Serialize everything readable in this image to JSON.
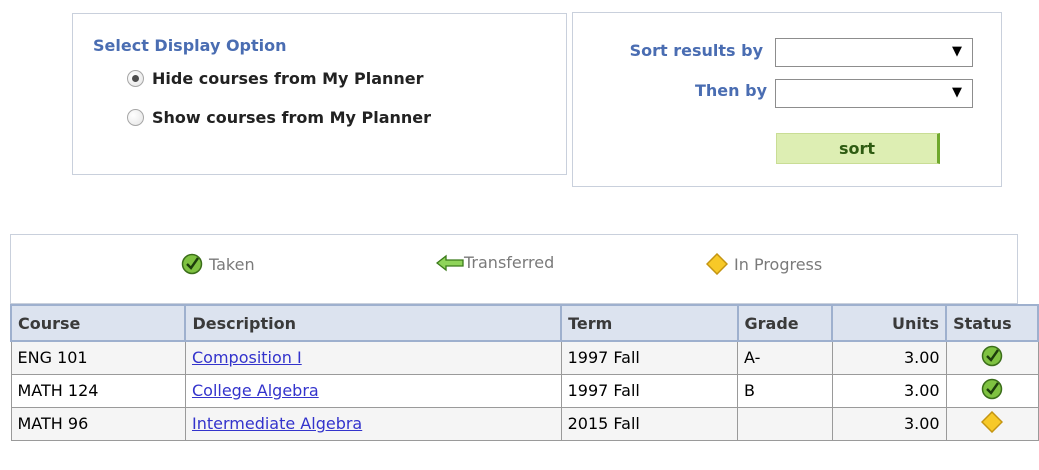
{
  "display_options": {
    "title": "Select Display Option",
    "options": [
      {
        "label": "Hide courses from My Planner",
        "selected": true
      },
      {
        "label": "Show courses from My Planner",
        "selected": false
      }
    ]
  },
  "sort": {
    "sort_by_label": "Sort results by",
    "then_by_label": "Then by",
    "sort_by_value": "",
    "then_by_value": "",
    "button_label": "sort"
  },
  "legend": {
    "taken": "Taken",
    "transferred": "Transferred",
    "in_progress": "In Progress"
  },
  "table": {
    "headers": {
      "course": "Course",
      "description": "Description",
      "term": "Term",
      "grade": "Grade",
      "units": "Units",
      "status": "Status"
    },
    "rows": [
      {
        "course": "ENG 101",
        "description": "Composition I",
        "term": "1997 Fall",
        "grade": "A-",
        "units": "3.00",
        "status": "taken"
      },
      {
        "course": "MATH 124",
        "description": "College Algebra",
        "term": "1997 Fall",
        "grade": "B",
        "units": "3.00",
        "status": "taken"
      },
      {
        "course": "MATH 96",
        "description": "Intermediate Algebra",
        "term": "2015 Fall",
        "grade": "",
        "units": "3.00",
        "status": "in-progress"
      }
    ]
  },
  "colors": {
    "label_blue": "#4a6db2",
    "sort_button_bg": "#ddeeb3",
    "link": "#3333cc",
    "taken_green": "#7fc241",
    "in_progress_yellow": "#f7c928"
  }
}
